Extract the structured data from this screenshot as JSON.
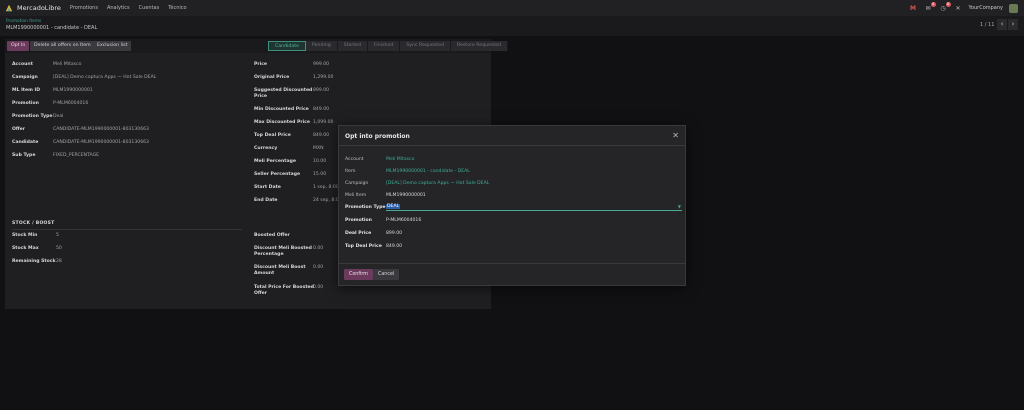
{
  "topbar": {
    "brand": "MercadoLibre",
    "menu": [
      "Promotions",
      "Analytics",
      "Cuentas",
      "Técnico"
    ],
    "badges": {
      "chat": "4",
      "activity": "8"
    },
    "company": "YourCompany"
  },
  "breadcrumb": {
    "parent": "Promotion Items",
    "current": "MLM1990000001 - candidate - DEAL"
  },
  "pager": {
    "text": "1 / 11"
  },
  "actions": {
    "opt_in": "Opt In",
    "delete_all": "Delete all offers on Item",
    "exclusion": "Exclusion list"
  },
  "stages": [
    "Candidate",
    "Pending",
    "Started",
    "Finished",
    "Sync Requested",
    "Restore Requested"
  ],
  "left_fields": [
    {
      "label": "Account",
      "value": "Meli Mitasco"
    },
    {
      "label": "Campaign",
      "value": "[DEAL] Demo captura Apps — Hot Sale DEAL"
    },
    {
      "label": "ML Item ID",
      "value": "MLM1990000001"
    },
    {
      "label": "Promotion",
      "value": "P-MLM6004016"
    },
    {
      "label": "Promotion Type",
      "value": "Deal"
    },
    {
      "label": "Offer",
      "value": "CANDIDATE-MLM1990000001-803130663"
    },
    {
      "label": "Candidate",
      "value": "CANDIDATE-MLM1990000001-803130663"
    },
    {
      "label": "Sub Type",
      "value": "FIXED_PERCENTAGE"
    }
  ],
  "right_fields": [
    {
      "label": "Price",
      "label2": "",
      "value": "999.00"
    },
    {
      "label": "Original Price",
      "label2": "",
      "value": "1,299.00"
    },
    {
      "label": "Suggested Discounted",
      "label2": "Price",
      "value": "899.00"
    },
    {
      "label": "Min Discounted Price",
      "label2": "",
      "value": "849.00"
    },
    {
      "label": "Max Discounted Price",
      "label2": "",
      "value": "1,099.00"
    },
    {
      "label": "Top Deal Price",
      "label2": "",
      "value": "849.00"
    },
    {
      "label": "Currency",
      "label2": "",
      "value": "MXN"
    },
    {
      "label": "Meli Percentage",
      "label2": "",
      "value": "10.00"
    },
    {
      "label": "Seller Percentage",
      "label2": "",
      "value": "15.00"
    },
    {
      "label": "Start Date",
      "label2": "",
      "value": "1 sep, 8:00"
    },
    {
      "label": "End Date",
      "label2": "",
      "value": "24 sep, 8:00"
    }
  ],
  "stock_section": {
    "title": "STOCK / BOOST",
    "fields": [
      {
        "label": "Stock Min",
        "value": "5"
      },
      {
        "label": "Stock Max",
        "value": "50"
      },
      {
        "label": "Remaining Stock",
        "value": "28"
      }
    ]
  },
  "boost_fields": [
    {
      "label": "Boosted Offer",
      "label2": "",
      "value": ""
    },
    {
      "label": "Discount Meli Boosted",
      "label2": "Percentage",
      "value": "0.00"
    },
    {
      "label": "Discount Meli Boost",
      "label2": "Amount",
      "value": "0.00"
    },
    {
      "label": "Total Price For Boosted",
      "label2": "Offer",
      "value": "0.00"
    }
  ],
  "modal": {
    "title": "Opt into promotion",
    "account_label": "Account",
    "account": "Meli Mitasco",
    "item_label": "Item",
    "item": "MLM1990000001 - candidate - DEAL",
    "campaign_label": "Campaign",
    "campaign": "[DEAL] Demo captura Apps — Hot Sale DEAL",
    "meli_item_label": "Meli Item",
    "meli_item": "MLM1990000001",
    "ptype_label": "Promotion Type",
    "ptype": "DEAL",
    "promotion_label": "Promotion",
    "promotion": "P-MLM6004016",
    "deal_price_label": "Deal Price",
    "deal_price": "899.00",
    "top_deal_label": "Top Deal Price",
    "top_deal": "849.00",
    "confirm": "Confirm",
    "cancel": "Cancel"
  },
  "colors": {
    "accent": "#3fae9a",
    "primary_button": "#6b3a5c",
    "background": "#111113"
  }
}
